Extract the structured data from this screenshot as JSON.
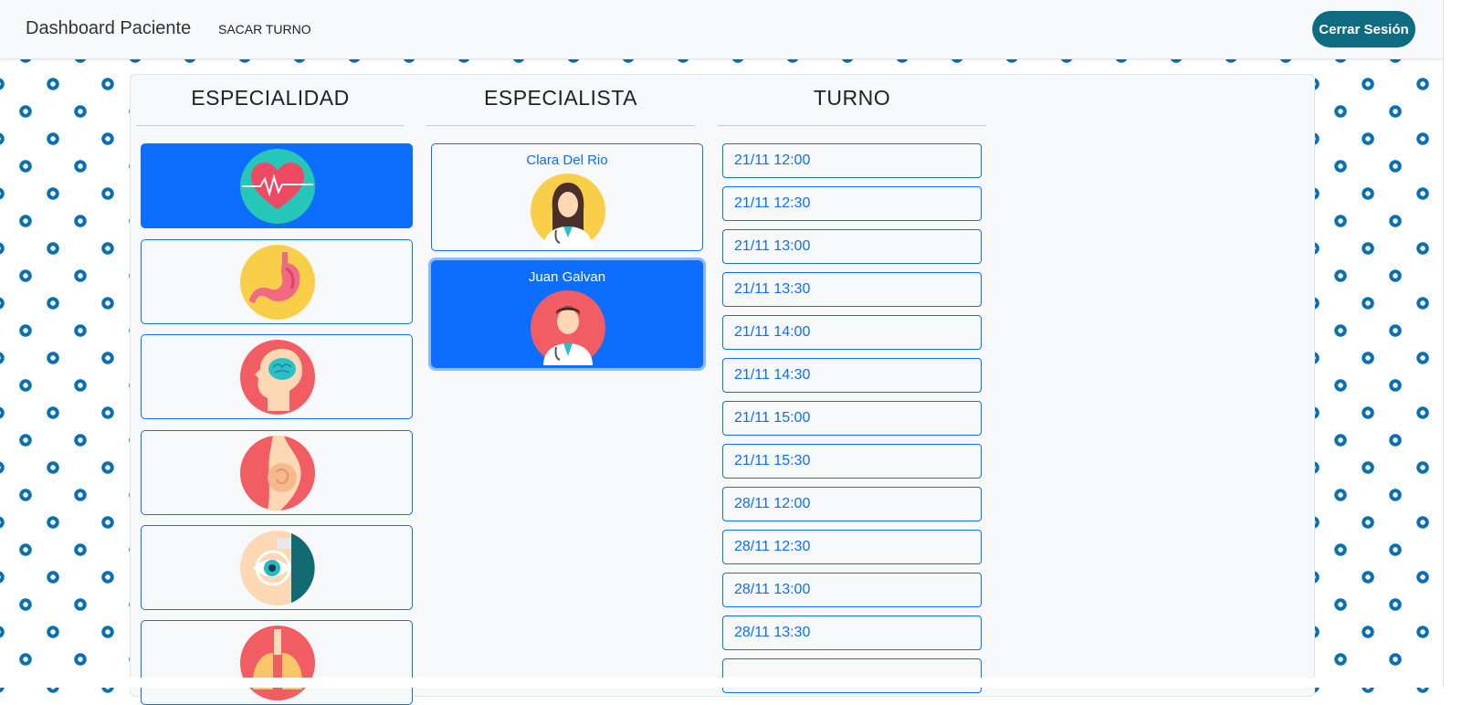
{
  "navbar": {
    "brand": "Dashboard Paciente",
    "link": "SACAR TURNO",
    "logout": "Cerrar Sesión",
    "logout_color": "#0e6b80"
  },
  "columns": {
    "specialty": {
      "title": "ESPECIALIDAD"
    },
    "specialist": {
      "title": "ESPECIALISTA"
    },
    "slot": {
      "title": "TURNO"
    }
  },
  "specialties": [
    {
      "icon": "cardiology-heart-icon",
      "selected": true
    },
    {
      "icon": "stomach-icon",
      "selected": false
    },
    {
      "icon": "brain-head-icon",
      "selected": false
    },
    {
      "icon": "pregnancy-icon",
      "selected": false
    },
    {
      "icon": "eye-exam-icon",
      "selected": false
    },
    {
      "icon": "lungs-icon",
      "selected": false
    }
  ],
  "specialists": [
    {
      "name": "Clara Del Rio",
      "icon": "female-doctor-icon",
      "selected": false
    },
    {
      "name": "Juan Galvan",
      "icon": "male-doctor-icon",
      "selected": true
    }
  ],
  "slots": [
    "21/11 12:00",
    "21/11 12:30",
    "21/11 13:00",
    "21/11 13:30",
    "21/11 14:00",
    "21/11 14:30",
    "21/11 15:00",
    "21/11 15:30",
    "28/11 12:00",
    "28/11 12:30",
    "28/11 13:00",
    "28/11 13:30",
    ""
  ],
  "colors": {
    "accent": "#0d6efd",
    "pattern": "#0b6fb0"
  }
}
